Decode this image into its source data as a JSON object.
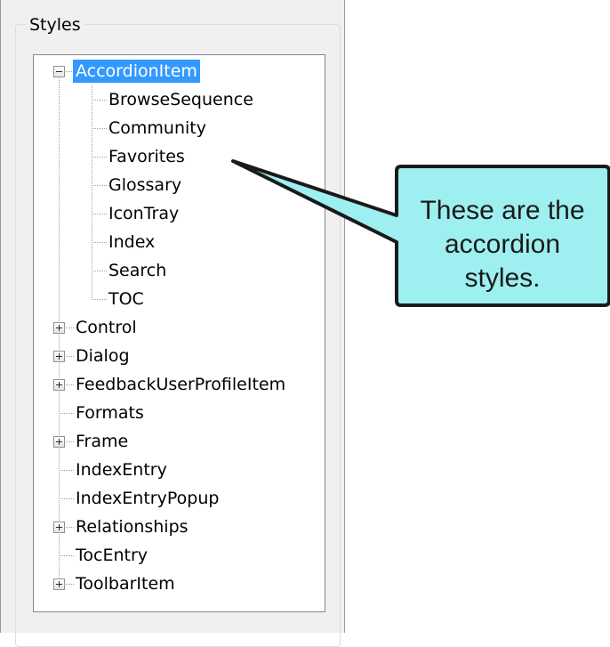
{
  "panel": {
    "group_title": "Styles"
  },
  "tree": {
    "items": [
      {
        "label": "AccordionItem",
        "level": 0,
        "toggle": "minus",
        "selected": true,
        "slug": "accordionitem"
      },
      {
        "label": "BrowseSequence",
        "level": 1,
        "toggle": "none",
        "slug": "browsesequence"
      },
      {
        "label": "Community",
        "level": 1,
        "toggle": "none",
        "slug": "community"
      },
      {
        "label": "Favorites",
        "level": 1,
        "toggle": "none",
        "slug": "favorites"
      },
      {
        "label": "Glossary",
        "level": 1,
        "toggle": "none",
        "slug": "glossary"
      },
      {
        "label": "IconTray",
        "level": 1,
        "toggle": "none",
        "slug": "icontray"
      },
      {
        "label": "Index",
        "level": 1,
        "toggle": "none",
        "slug": "index"
      },
      {
        "label": "Search",
        "level": 1,
        "toggle": "none",
        "slug": "search"
      },
      {
        "label": "TOC",
        "level": 1,
        "toggle": "none",
        "slug": "toc"
      },
      {
        "label": "Control",
        "level": 0,
        "toggle": "plus",
        "slug": "control"
      },
      {
        "label": "Dialog",
        "level": 0,
        "toggle": "plus",
        "slug": "dialog"
      },
      {
        "label": "FeedbackUserProfileItem",
        "level": 0,
        "toggle": "plus",
        "slug": "feedbackuserprofileitem"
      },
      {
        "label": "Formats",
        "level": 0,
        "toggle": "none",
        "slug": "formats"
      },
      {
        "label": "Frame",
        "level": 0,
        "toggle": "plus",
        "slug": "frame"
      },
      {
        "label": "IndexEntry",
        "level": 0,
        "toggle": "none",
        "slug": "indexentry"
      },
      {
        "label": "IndexEntryPopup",
        "level": 0,
        "toggle": "none",
        "slug": "indexentrypopup"
      },
      {
        "label": "Relationships",
        "level": 0,
        "toggle": "plus",
        "slug": "relationships"
      },
      {
        "label": "TocEntry",
        "level": 0,
        "toggle": "none",
        "slug": "tocentry"
      },
      {
        "label": "ToolbarItem",
        "level": 0,
        "toggle": "plus",
        "slug": "toolbaritem"
      }
    ]
  },
  "callout": {
    "text": "These are the accordion styles.",
    "fill": "#9eefef",
    "border": "#1a1a1a"
  },
  "colors": {
    "selection": "#3399ff",
    "tree_line": "#a0a0a0"
  }
}
